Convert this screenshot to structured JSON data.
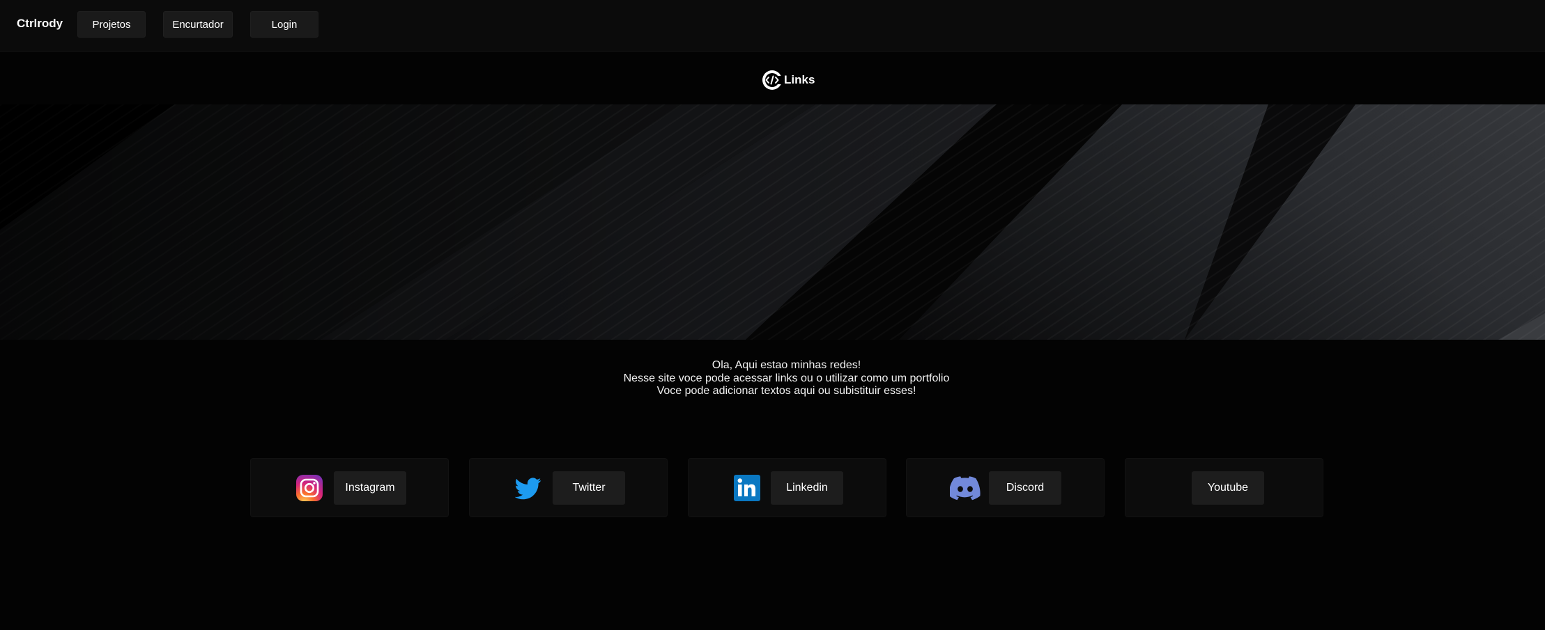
{
  "navbar": {
    "brand": "Ctrlrody",
    "items": [
      {
        "label": "Projetos"
      },
      {
        "label": "Encurtador"
      },
      {
        "label": "Login"
      }
    ]
  },
  "logo": {
    "label": "Links",
    "icon": "code-icon"
  },
  "intro": {
    "lines": [
      "Ola, Aqui estao minhas redes!",
      "Nesse site voce pode acessar links ou o utilizar como um portfolio",
      "Voce pode adicionar textos aqui ou subistituir esses!"
    ]
  },
  "links": [
    {
      "label": "Instagram",
      "icon": "instagram-icon"
    },
    {
      "label": "Twitter",
      "icon": "twitter-icon",
      "color": "#1d9bf0"
    },
    {
      "label": "Linkedin",
      "icon": "linkedin-icon",
      "color": "#0a66c2"
    },
    {
      "label": "Discord",
      "icon": "discord-icon",
      "color": "#7289da"
    },
    {
      "label": "Youtube"
    }
  ],
  "colors": {
    "background": "#030303",
    "navbar": "#0b0b0b",
    "button": "#1d1d1d",
    "card": "#0c0c0c"
  }
}
